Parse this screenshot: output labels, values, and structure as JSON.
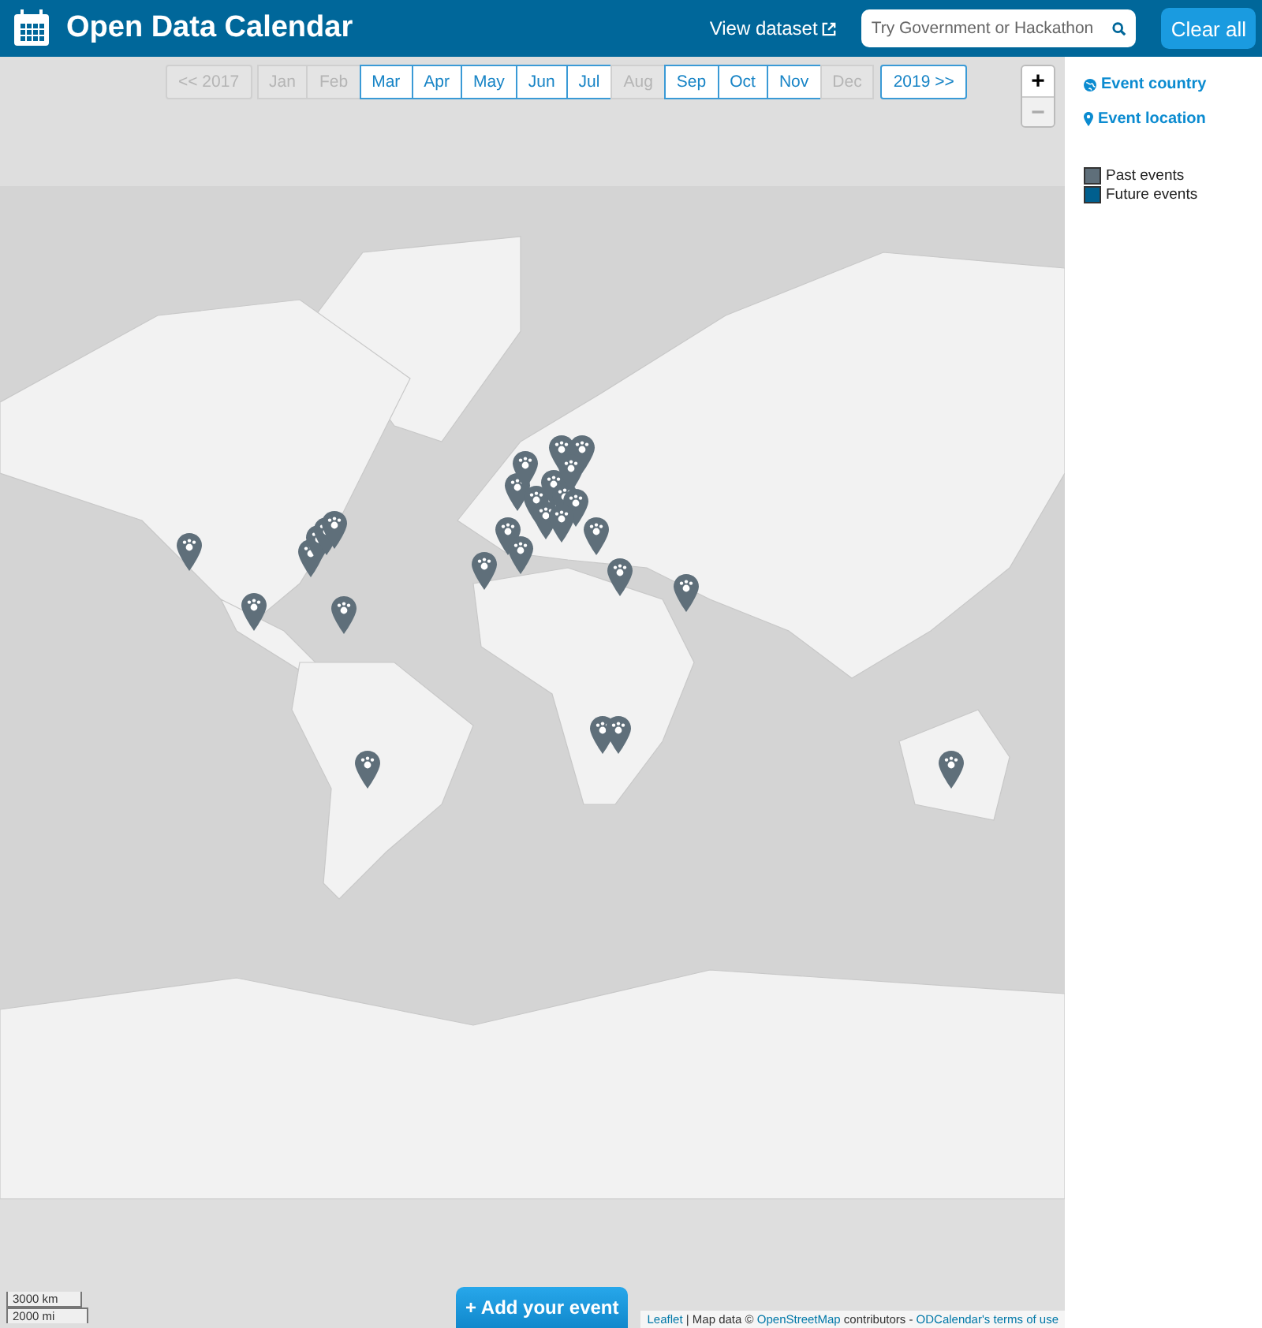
{
  "header": {
    "title": "Open Data Calendar",
    "view_dataset": "View dataset",
    "search": {
      "placeholder": "Try Government or Hackathon"
    },
    "clear_all": "Clear all"
  },
  "month_bar": {
    "prev": {
      "label": "<< 2017",
      "disabled": true
    },
    "months": [
      {
        "label": "Jan",
        "disabled": true
      },
      {
        "label": "Feb",
        "disabled": true
      },
      {
        "label": "Mar",
        "disabled": false
      },
      {
        "label": "Apr",
        "disabled": false
      },
      {
        "label": "May",
        "disabled": false
      },
      {
        "label": "Jun",
        "disabled": false
      },
      {
        "label": "Jul",
        "disabled": false
      },
      {
        "label": "Aug",
        "disabled": true
      },
      {
        "label": "Sep",
        "disabled": false
      },
      {
        "label": "Oct",
        "disabled": false
      },
      {
        "label": "Nov",
        "disabled": false
      },
      {
        "label": "Dec",
        "disabled": true
      }
    ],
    "next": {
      "label": "2019 >>",
      "disabled": false
    }
  },
  "map": {
    "zoom_in": {
      "label": "+",
      "disabled": false
    },
    "zoom_out": {
      "label": "−",
      "disabled": true
    },
    "scale": [
      "3000 km",
      "2000 mi"
    ],
    "add_event": "+ Add your event",
    "attribution": [
      {
        "kind": "link",
        "text": "Leaflet"
      },
      {
        "kind": "text",
        "text": " | Map data © "
      },
      {
        "kind": "link",
        "text": "OpenStreetMap"
      },
      {
        "kind": "text",
        "text": " contributors - "
      },
      {
        "kind": "link",
        "text": "ODCalendar's terms of use"
      }
    ]
  },
  "sidebar": {
    "filters": [
      {
        "kind": "globe",
        "label": "Event country"
      },
      {
        "kind": "pin",
        "label": "Event location"
      }
    ],
    "legend": [
      {
        "label": "Past events",
        "color": "#5f6f7a"
      },
      {
        "label": "Future events",
        "color": "#005f8e"
      }
    ]
  }
}
